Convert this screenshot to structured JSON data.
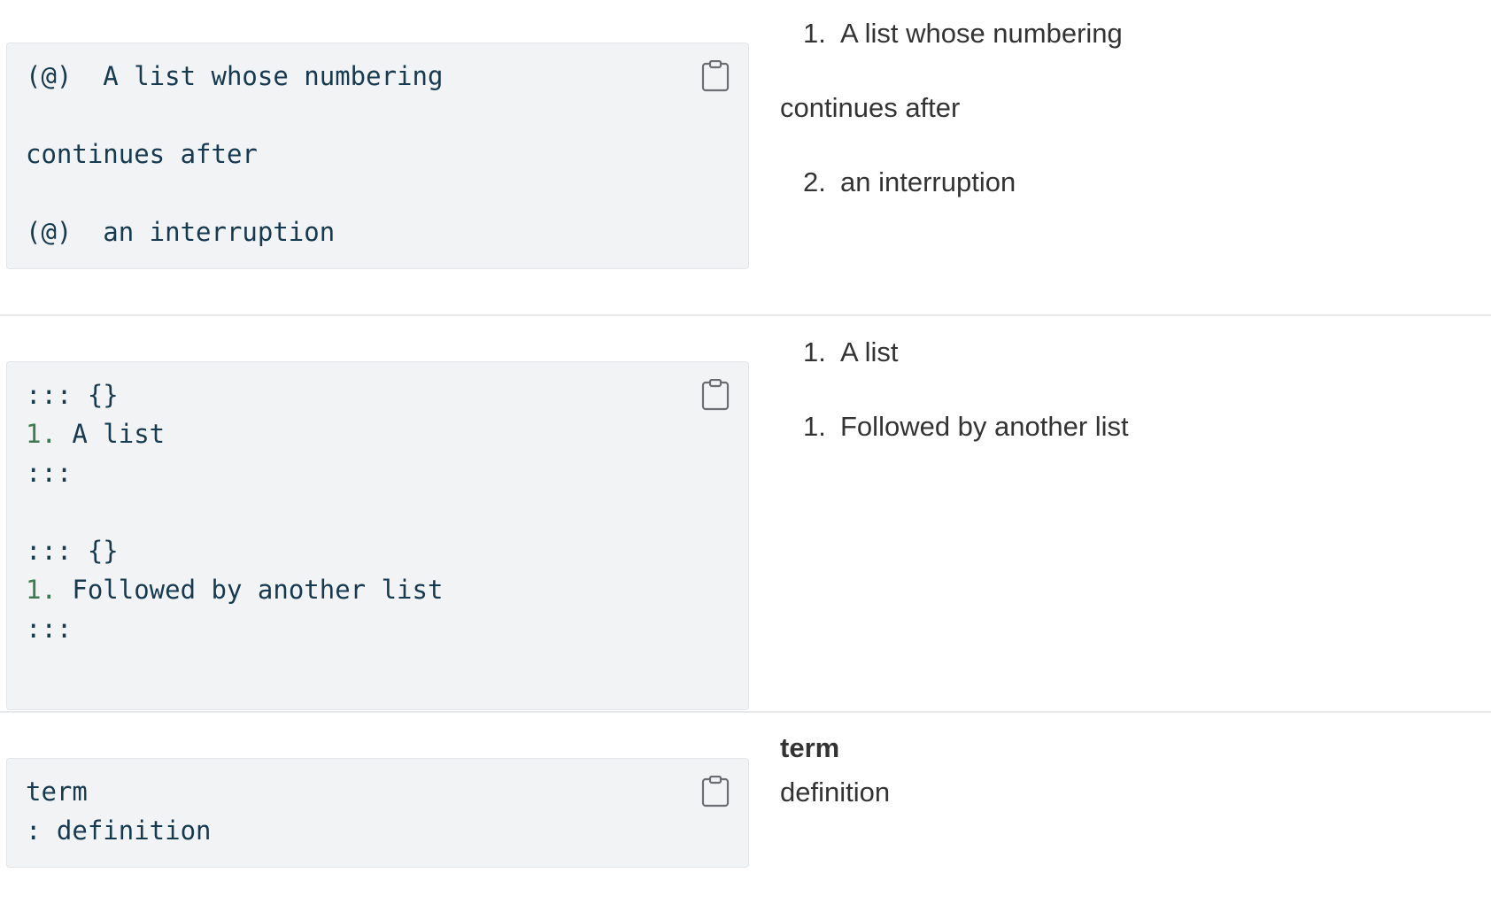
{
  "blocks": [
    {
      "source": {
        "lines": [
          {
            "prefix": "",
            "text": "(@)  A list whose numbering"
          },
          {
            "prefix": "",
            "text": "continues after"
          },
          {
            "prefix": "",
            "text": "(@)  an interruption"
          }
        ]
      },
      "output": {
        "items": [
          {
            "marker": "1.",
            "text": "A list whose numbering"
          },
          {
            "marker": "",
            "text": "continues after"
          },
          {
            "marker": "2.",
            "text": "an interruption"
          }
        ]
      }
    },
    {
      "source": {
        "lines": [
          {
            "prefix": "",
            "text": "::: {}"
          },
          {
            "prefix": "1.",
            "text": " A list"
          },
          {
            "prefix": "",
            "text": ":::"
          },
          {
            "prefix": "",
            "text": "::: {}"
          },
          {
            "prefix": "1.",
            "text": " Followed by another list"
          },
          {
            "prefix": "",
            "text": ":::"
          }
        ]
      },
      "output": {
        "items": [
          {
            "marker": "1.",
            "text": "A list"
          },
          {
            "marker": "1.",
            "text": "Followed by another list"
          }
        ]
      }
    },
    {
      "source": {
        "lines": [
          {
            "prefix": "",
            "text": "term"
          },
          {
            "prefix": "",
            "text": ": definition"
          }
        ]
      },
      "output": {
        "term": "term",
        "definition": "definition"
      }
    }
  ],
  "icons": {
    "copy": "clipboard-icon"
  },
  "colors": {
    "code_text": "#163a4f",
    "list_number": "#3c7a52",
    "code_background": "#f2f3f5"
  }
}
